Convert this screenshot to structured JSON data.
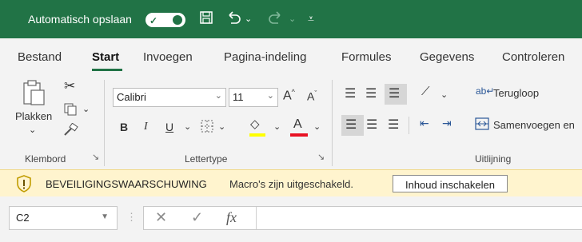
{
  "titlebar": {
    "autosave_label": "Automatisch opslaan",
    "autosave_state": "Aan",
    "autosave_icon": "toggle-on-icon",
    "save_icon": "save-icon",
    "undo_icon": "undo-icon",
    "redo_icon": "redo-icon",
    "customize_icon": "customize-qat-icon"
  },
  "tabs": [
    "Bestand",
    "Start",
    "Invoegen",
    "Pagina-indeling",
    "Formules",
    "Gegevens",
    "Controleren"
  ],
  "active_tab": "Start",
  "ribbon": {
    "clipboard": {
      "paste_label": "Plakken",
      "group_label": "Klembord"
    },
    "font": {
      "font_name": "Calibri",
      "font_size": "11",
      "bold": "B",
      "italic": "I",
      "underline": "U",
      "font_color_letter": "A",
      "group_label": "Lettertype"
    },
    "alignment": {
      "wrap_text": "Terugloop",
      "merge_center": "Samenvoegen en",
      "group_label": "Uitlijning"
    }
  },
  "security_banner": {
    "title": "BEVEILIGINGSWAARSCHUWING",
    "message": "Macro's zijn uitgeschakeld.",
    "button": "Inhoud inschakelen"
  },
  "formula_bar": {
    "name_box": "C2",
    "fx_label": "fx",
    "formula": ""
  },
  "colors": {
    "accent": "#217346",
    "banner_bg": "#fff4ce",
    "font_color_bar": "#e81123",
    "fill_color_bar": "#ffff00"
  }
}
